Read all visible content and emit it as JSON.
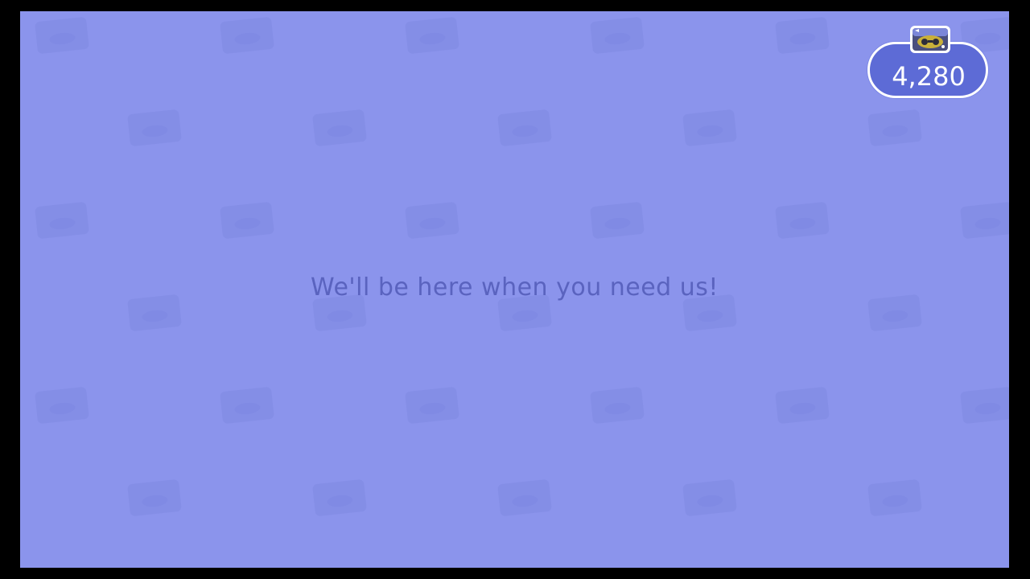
{
  "screen": {
    "background_color": "#8b94ec",
    "pattern_color": "#7f89e2"
  },
  "message": {
    "text": "We'll be here when you need us!"
  },
  "currency": {
    "icon": "miles-ticket-icon",
    "value": "4,280",
    "pill_color": "#5d6bd6"
  }
}
